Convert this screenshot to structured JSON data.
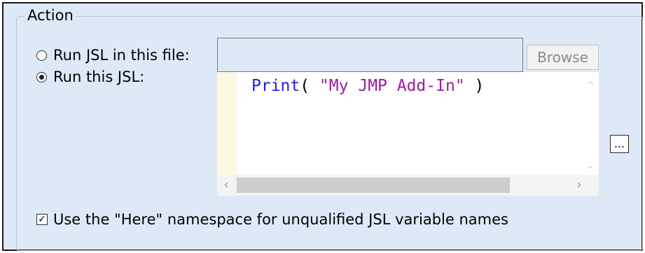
{
  "group": {
    "title": "Action"
  },
  "options": {
    "run_file_label": "Run JSL in this file:",
    "run_file_selected": false,
    "run_jsl_label": "Run this JSL:",
    "run_jsl_selected": true
  },
  "file_input": {
    "value": "",
    "placeholder": ""
  },
  "browse_button": {
    "label": "Browse",
    "enabled": false
  },
  "editor": {
    "code_fn": "Print",
    "code_open": "( ",
    "code_string": "\"My JMP Add-In\"",
    "code_close": " )"
  },
  "ellipsis_button": {
    "label": "..."
  },
  "namespace_option": {
    "label": "Use the \"Here\" namespace for unqualified JSL variable names",
    "checked": true,
    "check_mark": "✓"
  },
  "icons": {
    "scroll_up": "^",
    "scroll_down": "⌄",
    "scroll_left": "‹",
    "scroll_right": "›"
  }
}
